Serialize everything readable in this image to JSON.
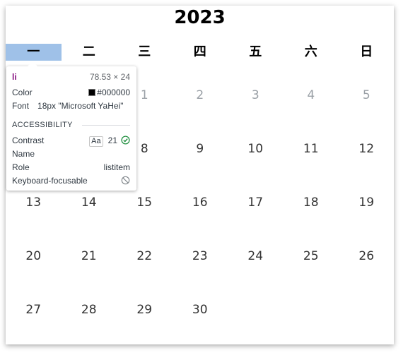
{
  "calendar": {
    "year": "2023",
    "weekdays": [
      "一",
      "二",
      "三",
      "四",
      "五",
      "六",
      "日"
    ],
    "first_row": [
      "1",
      "2",
      "3",
      "4",
      "5"
    ],
    "weeks": [
      [
        "",
        "",
        "8",
        "9",
        "10",
        "11",
        "12"
      ],
      [
        "13",
        "14",
        "15",
        "16",
        "17",
        "18",
        "19"
      ],
      [
        "20",
        "21",
        "22",
        "23",
        "24",
        "25",
        "26"
      ],
      [
        "27",
        "28",
        "29",
        "30"
      ]
    ]
  },
  "inspector": {
    "tag": "li",
    "size": "78.53 × 24",
    "color_label": "Color",
    "color_value": "#000000",
    "font_label": "Font",
    "font_value": "18px \"Microsoft YaHei\"",
    "section_title": "ACCESSIBILITY",
    "contrast_label": "Contrast",
    "contrast_badge": "Aa",
    "contrast_value": "21",
    "name_label": "Name",
    "role_label": "Role",
    "role_value": "listitem",
    "keyboard_label": "Keyboard-focusable",
    "colors": {
      "swatch": "#000000",
      "tag": "#881280",
      "pass": "#1e8e3e",
      "highlight": "#9fc1e8"
    }
  }
}
